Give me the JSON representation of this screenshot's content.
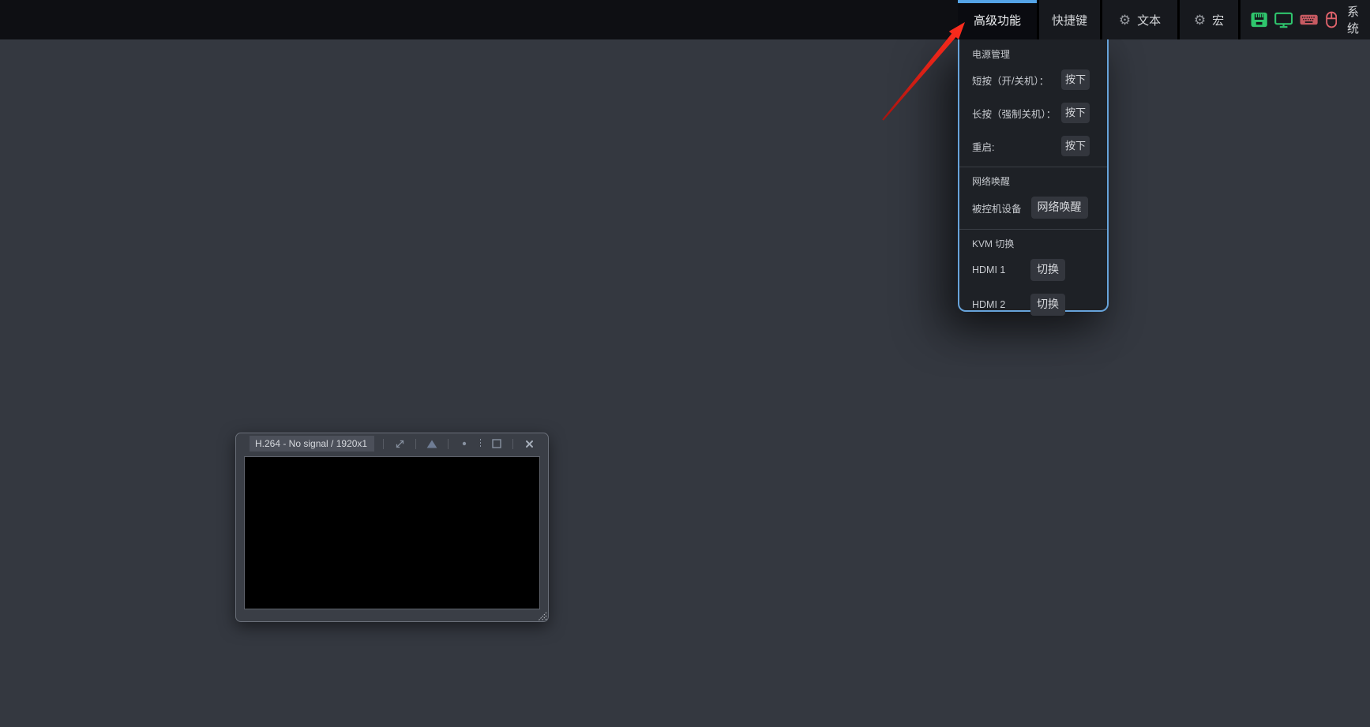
{
  "colors": {
    "accent_blue": "#54a3e6",
    "panel_border_blue": "#67a3da",
    "status_green": "#2fc56d",
    "status_red": "#e0636c",
    "arrow_red": "#ee2418"
  },
  "topbar": {
    "menu": [
      {
        "key": "advanced",
        "label": "高级功能",
        "active": true,
        "icon": null
      },
      {
        "key": "hotkeys",
        "label": "快捷键",
        "active": false,
        "icon": null
      },
      {
        "key": "text",
        "label": "文本",
        "active": false,
        "icon": "gear"
      },
      {
        "key": "macro",
        "label": "宏",
        "active": false,
        "icon": "gear"
      },
      {
        "key": "system",
        "label": "系统",
        "active": false,
        "icon": null
      }
    ],
    "status_icons": [
      {
        "name": "ethernet",
        "color": "#2fc56d"
      },
      {
        "name": "display",
        "color": "#2fc56d"
      },
      {
        "name": "keyboard",
        "color": "#e0636c"
      },
      {
        "name": "mouse",
        "color": "#e0636c"
      }
    ]
  },
  "dropdown": {
    "sections": [
      {
        "title": "电源管理",
        "rows": [
          {
            "name": "power-short-press",
            "label": "短按（开/关机）：",
            "button": "按下"
          },
          {
            "name": "power-long-press",
            "label": "长按（强制关机）：",
            "button": "按下"
          },
          {
            "name": "power-restart",
            "label": "重启:",
            "button": "按下"
          }
        ]
      },
      {
        "title": "网络唤醒",
        "rows": [
          {
            "name": "wake-on-lan",
            "label": "被控机设备",
            "button": "网络唤醒"
          }
        ]
      },
      {
        "title": "KVM 切换",
        "rows": [
          {
            "name": "kvm-hdmi1",
            "label": "HDMI 1",
            "button": "切换"
          },
          {
            "name": "kvm-hdmi2",
            "label": "HDMI 2",
            "button": "切换"
          }
        ]
      }
    ]
  },
  "video_window": {
    "title": "H.264 - No signal / 1920x1",
    "toolbar_icons": [
      "expand",
      "triangle",
      "dot",
      "square",
      "close"
    ]
  }
}
